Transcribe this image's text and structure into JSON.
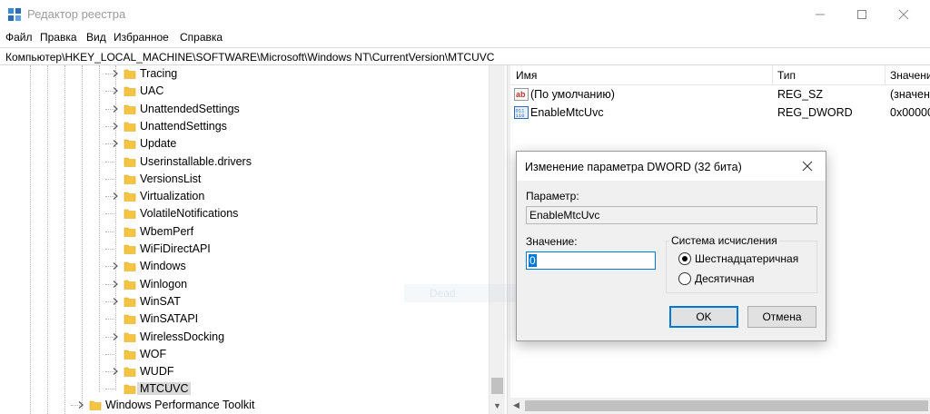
{
  "window": {
    "title": "Редактор реестра"
  },
  "menu": [
    "Файл",
    "Правка",
    "Вид",
    "Избранное",
    "Справка"
  ],
  "address": "Компьютер\\HKEY_LOCAL_MACHINE\\SOFTWARE\\Microsoft\\Windows NT\\CurrentVersion\\MTCUVC",
  "tree": {
    "items": [
      {
        "label": "Tracing",
        "expandable": true
      },
      {
        "label": "UAC",
        "expandable": true
      },
      {
        "label": "UnattendedSettings",
        "expandable": true
      },
      {
        "label": "UnattendSettings",
        "expandable": true
      },
      {
        "label": "Update",
        "expandable": true
      },
      {
        "label": "Userinstallable.drivers",
        "expandable": false
      },
      {
        "label": "VersionsList",
        "expandable": false
      },
      {
        "label": "Virtualization",
        "expandable": true
      },
      {
        "label": "VolatileNotifications",
        "expandable": false
      },
      {
        "label": "WbemPerf",
        "expandable": false
      },
      {
        "label": "WiFiDirectAPI",
        "expandable": false
      },
      {
        "label": "Windows",
        "expandable": true
      },
      {
        "label": "Winlogon",
        "expandable": true
      },
      {
        "label": "WinSAT",
        "expandable": true
      },
      {
        "label": "WinSATAPI",
        "expandable": false
      },
      {
        "label": "WirelessDocking",
        "expandable": true
      },
      {
        "label": "WOF",
        "expandable": false
      },
      {
        "label": "WUDF",
        "expandable": true
      },
      {
        "label": "MTCUVC",
        "expandable": false,
        "selected": true
      }
    ],
    "parent_item": {
      "label": "Windows Performance Toolkit",
      "expandable": true
    }
  },
  "list": {
    "columns": {
      "name": "Имя",
      "type": "Тип",
      "value": "Значени"
    },
    "rows": [
      {
        "icon": "string-value-icon",
        "name": "(По умолчанию)",
        "type": "REG_SZ",
        "value": "(значен"
      },
      {
        "icon": "binary-value-icon",
        "name": "EnableMtcUvc",
        "type": "REG_DWORD",
        "value": "0x00000"
      }
    ]
  },
  "ghost": {
    "label": "Dead"
  },
  "dialog": {
    "title": "Изменение параметра DWORD (32 бита)",
    "param_label": "Параметр:",
    "param_value": "EnableMtcUvc",
    "value_label": "Значение:",
    "value": "0",
    "base_group_label": "Система исчисления",
    "base_hex_label": "Шестнадцатеричная",
    "base_dec_label": "Десятичная",
    "base_selected": "hex",
    "ok_label": "OK",
    "cancel_label": "Отмена"
  },
  "colors": {
    "accent": "#0078d7",
    "folder": "#f5c542",
    "selection": "#d9d9d9"
  }
}
